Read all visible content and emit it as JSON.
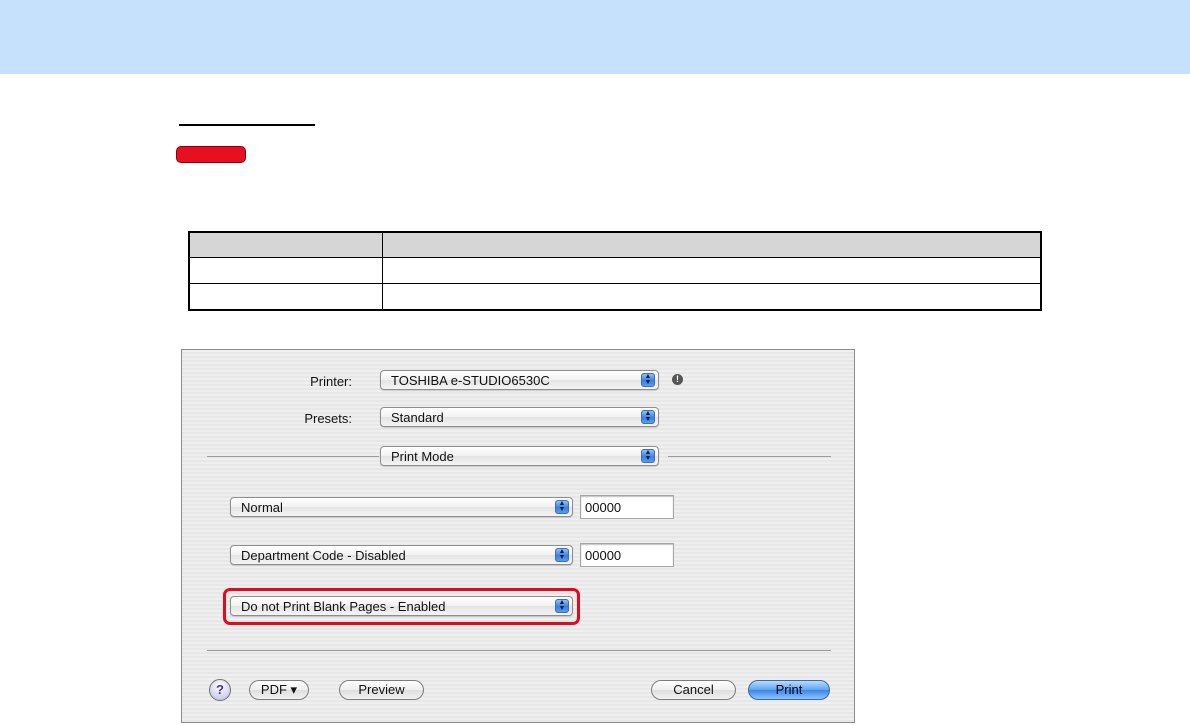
{
  "dialog": {
    "printer_label": "Printer:",
    "printer_value": "TOSHIBA e-STUDIO6530C",
    "presets_label": "Presets:",
    "presets_value": "Standard",
    "panel_value": "Print Mode",
    "print_mode_value": "Normal",
    "print_mode_code": "00000",
    "dept_code_value": "Department Code - Disabled",
    "dept_code_code": "00000",
    "blank_pages_value": "Do not Print Blank Pages - Enabled",
    "help_label": "?",
    "pdf_label": "PDF ▾",
    "preview_label": "Preview",
    "cancel_label": "Cancel",
    "print_label": "Print"
  },
  "colors": {
    "banner": "#c6e1fb",
    "tag": "#e8101e",
    "highlight": "#e40a1d"
  },
  "icons": {
    "warning": "warning-icon",
    "popup_arrows": "popup-arrows-icon",
    "help": "help-icon"
  }
}
